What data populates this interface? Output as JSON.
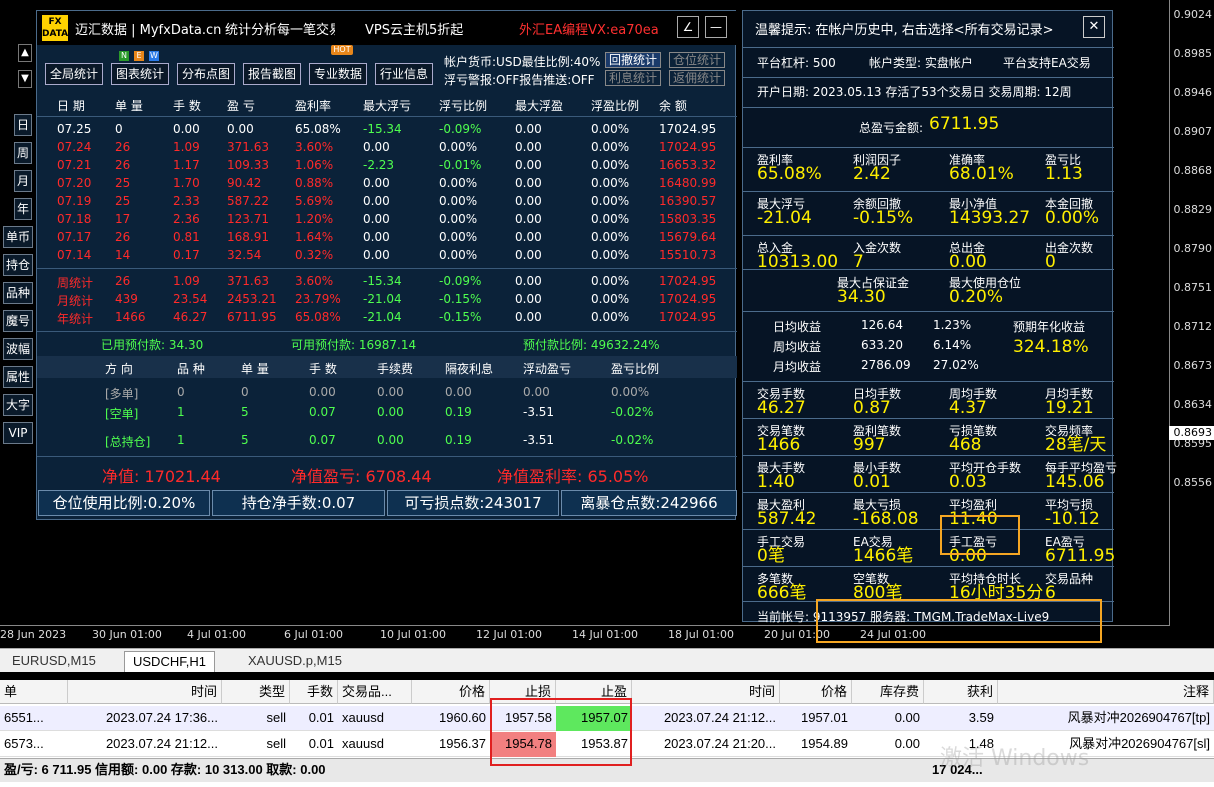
{
  "price_scale": {
    "levels": [
      "0.9024",
      "0.8985",
      "0.8946",
      "0.8907",
      "0.8868",
      "0.8829",
      "0.8790",
      "0.8751",
      "0.8712",
      "0.8673",
      "0.8634",
      "0.8595",
      "0.8556"
    ],
    "current": "0.8693"
  },
  "x_axis": [
    "28 Jun 2023",
    "30 Jun 01:00",
    "4 Jul 01:00",
    "6 Jul 01:00",
    "10 Jul 01:00",
    "12 Jul 01:00",
    "14 Jul 01:00",
    "18 Jul 01:00",
    "20 Jul 01:00",
    "24 Jul 01:00"
  ],
  "side_buttons": [
    "日",
    "周",
    "月",
    "年",
    "单币",
    "持仓",
    "品种",
    "魔号",
    "波幅",
    "属性",
    "大字",
    "VIP"
  ],
  "titlebar": {
    "logo": "FX DATA",
    "brand": "迈汇数据 | MyfxData.cn",
    "slogan": "统计分析每一笔交易",
    "vps": "VPS云主机5折起",
    "promo": "外汇EA编程VX:ea70ea",
    "edit_icon": "∠",
    "min_icon": "—"
  },
  "toolbar": {
    "buttons": [
      "全局统计",
      "图表统计",
      "分布点图",
      "报告截图",
      "专业数据",
      "行业信息"
    ],
    "badges": {
      "n": "N",
      "e": "E",
      "w": "W",
      "hot": "HOT"
    },
    "info1": "帐户货币:USD最佳比例:40%",
    "info2": "浮亏警报:OFF报告推送:OFF",
    "btn_huiche": "回撤统计",
    "btn_cangwei": "仓位统计",
    "btn_lixi": "利息统计",
    "btn_fanyong": "返佣统计"
  },
  "stats_table": {
    "headers": [
      "日 期",
      "单 量",
      "手 数",
      "盈 亏",
      "盈利率",
      "最大浮亏",
      "浮亏比例",
      "最大浮盈",
      "浮盈比例",
      "余 额"
    ],
    "rows": [
      {
        "c": [
          "07.25",
          "0",
          "0.00",
          "0.00",
          "65.08%",
          "-15.34",
          "-0.09%",
          "0.00",
          "0.00%",
          "17024.95"
        ]
      },
      {
        "c": [
          "07.24",
          "26",
          "1.09",
          "371.63",
          "3.60%",
          "0.00",
          "0.00%",
          "0.00",
          "0.00%",
          "17024.95"
        ]
      },
      {
        "c": [
          "07.21",
          "26",
          "1.17",
          "109.33",
          "1.06%",
          "-2.23",
          "-0.01%",
          "0.00",
          "0.00%",
          "16653.32"
        ]
      },
      {
        "c": [
          "07.20",
          "25",
          "1.70",
          "90.42",
          "0.88%",
          "0.00",
          "0.00%",
          "0.00",
          "0.00%",
          "16480.99"
        ]
      },
      {
        "c": [
          "07.19",
          "25",
          "2.33",
          "587.22",
          "5.69%",
          "0.00",
          "0.00%",
          "0.00",
          "0.00%",
          "16390.57"
        ]
      },
      {
        "c": [
          "07.18",
          "17",
          "2.36",
          "123.71",
          "1.20%",
          "0.00",
          "0.00%",
          "0.00",
          "0.00%",
          "15803.35"
        ]
      },
      {
        "c": [
          "07.17",
          "26",
          "0.81",
          "168.91",
          "1.64%",
          "0.00",
          "0.00%",
          "0.00",
          "0.00%",
          "15679.64"
        ]
      },
      {
        "c": [
          "07.14",
          "14",
          "0.17",
          "32.54",
          "0.32%",
          "0.00",
          "0.00%",
          "0.00",
          "0.00%",
          "15510.73"
        ]
      }
    ],
    "summary": [
      {
        "c": [
          "周统计",
          "26",
          "1.09",
          "371.63",
          "3.60%",
          "-15.34",
          "-0.09%",
          "0.00",
          "0.00%",
          "17024.95"
        ]
      },
      {
        "c": [
          "月统计",
          "439",
          "23.54",
          "2453.21",
          "23.79%",
          "-21.04",
          "-0.15%",
          "0.00",
          "0.00%",
          "17024.95"
        ]
      },
      {
        "c": [
          "年统计",
          "1466",
          "46.27",
          "6711.95",
          "65.08%",
          "-21.04",
          "-0.15%",
          "0.00",
          "0.00%",
          "17024.95"
        ]
      }
    ]
  },
  "margin": {
    "used": "已用预付款: 34.30",
    "available": "可用预付款: 16987.14",
    "ratio": "预付款比例: 49632.24%"
  },
  "positions": {
    "headers": [
      "方 向",
      "品 种",
      "单 量",
      "手 数",
      "手续费",
      "隔夜利息",
      "浮动盈亏",
      "盈亏比例"
    ],
    "rows": [
      {
        "c": [
          "[多单]",
          "0",
          "0",
          "0.00",
          "0.00",
          "0.00",
          "0.00",
          "0.00%"
        ]
      },
      {
        "c": [
          "[空单]",
          "1",
          "5",
          "0.07",
          "0.00",
          "0.19",
          "-3.51",
          "-0.02%"
        ]
      },
      {
        "c": [
          "[总持仓]",
          "1",
          "5",
          "0.07",
          "0.00",
          "0.19",
          "-3.51",
          "-0.02%"
        ]
      }
    ]
  },
  "equity": {
    "net": "净值: 17021.44",
    "pnl": "净值盈亏: 6708.44",
    "rate": "净值盈利率: 65.05%"
  },
  "bottom_bar": [
    "仓位使用比例:0.20%",
    "持仓净手数:0.07",
    "可亏损点数:243017",
    "离暴仓点数:242966"
  ],
  "right_panel": {
    "tip": "温馨提示: 在帐户历史中, 右击选择<所有交易记录>",
    "close_icon": "✕",
    "leverage": "平台杠杆: 500",
    "account_type": "帐户类型: 实盘帐户",
    "ea_support": "平台支持EA交易",
    "open_info": "开户日期: 2023.05.13 存活了53个交易日 交易周期: 12周",
    "total_label": "总盈亏金额:",
    "total_value": "6711.95",
    "metrics": [
      {
        "l": "盈利率",
        "v": "65.08%"
      },
      {
        "l": "利润因子",
        "v": "2.42"
      },
      {
        "l": "准确率",
        "v": "68.01%"
      },
      {
        "l": "盈亏比",
        "v": "1.13"
      },
      {
        "l": "最大浮亏",
        "v": "-21.04"
      },
      {
        "l": "余额回撤",
        "v": "-0.15%"
      },
      {
        "l": "最小净值",
        "v": "14393.27"
      },
      {
        "l": "本金回撤",
        "v": "0.00%"
      },
      {
        "l": "总入金",
        "v": "10313.00"
      },
      {
        "l": "入金次数",
        "v": "7"
      },
      {
        "l": "总出金",
        "v": "0.00"
      },
      {
        "l": "出金次数",
        "v": "0"
      }
    ],
    "margin_metrics": [
      {
        "l": "最大占保证金",
        "v": "34.30"
      },
      {
        "l": "最大使用仓位",
        "v": "0.20%"
      }
    ],
    "avg": {
      "rows": [
        {
          "l": "日均收益",
          "a": "126.64",
          "p": "1.23%"
        },
        {
          "l": "周均收益",
          "a": "633.20",
          "p": "6.14%"
        },
        {
          "l": "月均收益",
          "a": "2786.09",
          "p": "27.02%"
        }
      ],
      "annual_label": "预期年化收益",
      "annual_value": "324.18%"
    },
    "metrics2": [
      {
        "l": "交易手数",
        "v": "46.27"
      },
      {
        "l": "日均手数",
        "v": "0.87"
      },
      {
        "l": "周均手数",
        "v": "4.37"
      },
      {
        "l": "月均手数",
        "v": "19.21"
      },
      {
        "l": "交易笔数",
        "v": "1466"
      },
      {
        "l": "盈利笔数",
        "v": "997"
      },
      {
        "l": "亏损笔数",
        "v": "468"
      },
      {
        "l": "交易频率",
        "v": "28笔/天"
      },
      {
        "l": "最大手数",
        "v": "1.40"
      },
      {
        "l": "最小手数",
        "v": "0.01"
      },
      {
        "l": "平均开仓手数",
        "v": "0.03"
      },
      {
        "l": "每手平均盈亏",
        "v": "145.06"
      },
      {
        "l": "最大盈利",
        "v": "587.42"
      },
      {
        "l": "最大亏损",
        "v": "-168.08"
      },
      {
        "l": "平均盈利",
        "v": "11.40"
      },
      {
        "l": "平均亏损",
        "v": "-10.12"
      },
      {
        "l": "手工交易",
        "v": "0笔"
      },
      {
        "l": "EA交易",
        "v": "1466笔"
      },
      {
        "l": "手工盈亏",
        "v": "0.00"
      },
      {
        "l": "EA盈亏",
        "v": "6711.95"
      },
      {
        "l": "多笔数",
        "v": "666笔"
      },
      {
        "l": "空笔数",
        "v": "800笔"
      },
      {
        "l": "平均持仓时长",
        "v": "16小时35分"
      },
      {
        "l": "交易品种",
        "v": "6"
      }
    ],
    "account_line": "当前帐号: 9113957 服务器: TMGM.TradeMax-Live9"
  },
  "tabs": [
    "EURUSD,M15",
    "USDCHF,H1",
    "XAUUSD.p,M15"
  ],
  "trade_table": {
    "headers": [
      "单",
      "时间",
      "类型",
      "手数",
      "交易品...",
      "价格",
      "止损",
      "止盈",
      "时间",
      "价格",
      "库存费",
      "获利",
      "注释"
    ],
    "rows": [
      {
        "c": [
          "6551...",
          "2023.07.24 17:36...",
          "sell",
          "0.01",
          "xauusd",
          "1960.60",
          "1957.58",
          "1957.07",
          "2023.07.24 21:12...",
          "1957.01",
          "0.00",
          "3.59",
          "风暴对冲2026904767[tp]"
        ]
      },
      {
        "c": [
          "6573...",
          "2023.07.24 21:12...",
          "sell",
          "0.01",
          "xauusd",
          "1956.37",
          "1954.78",
          "1953.87",
          "2023.07.24 21:20...",
          "1954.89",
          "0.00",
          "1.48",
          "风暴对冲2026904767[sl]"
        ]
      }
    ],
    "summary": "盈/亏: 6 711.95  信用额: 0.00  存款: 10 313.00  取款: 0.00",
    "summary_right": "17 024..."
  },
  "watermark": "激活 Windows",
  "colors": {
    "panel": "#0b2239",
    "red": "#ff2a2a",
    "yellow": "#ffef00",
    "green": "#4fff4f",
    "orange": "#f5a623"
  }
}
